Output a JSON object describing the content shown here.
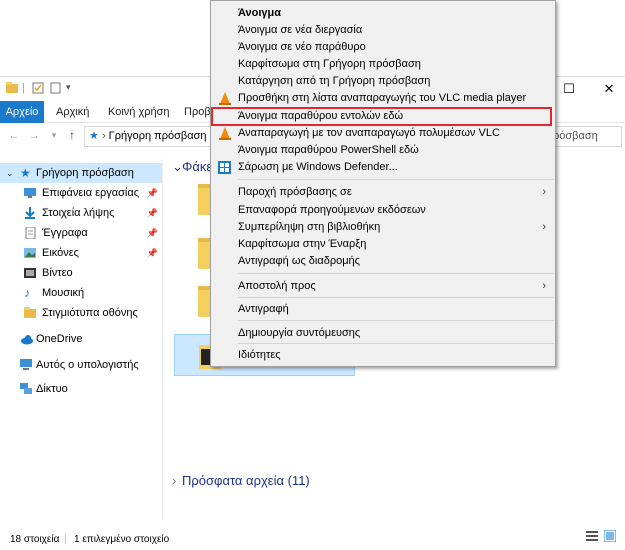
{
  "window": {
    "tabs": [
      "Αρχείο",
      "Αρχική",
      "Κοινή χρήση",
      "Προβ"
    ],
    "address": "Γρήγορη πρόσβαση",
    "search_placeholder": "ρόσβαση"
  },
  "nav": {
    "items": [
      {
        "label": "Γρήγορη πρόσβαση",
        "icon": "star-icon"
      },
      {
        "label": "Επιφάνεια εργασίας",
        "icon": "desktop-icon"
      },
      {
        "label": "Στοιχεία λήψης",
        "icon": "download-icon"
      },
      {
        "label": "Έγγραφα",
        "icon": "documents-icon"
      },
      {
        "label": "Εικόνες",
        "icon": "pictures-icon"
      },
      {
        "label": "Βίντεο",
        "icon": "video-icon"
      },
      {
        "label": "Μουσική",
        "icon": "music-icon"
      },
      {
        "label": "Στιγμιότυπα οθόνης",
        "icon": "folder-icon"
      },
      {
        "label": "OneDrive",
        "icon": "cloud-icon"
      },
      {
        "label": "Αυτός ο υπολογιστής",
        "icon": "computer-icon"
      },
      {
        "label": "Δίκτυο",
        "icon": "network-icon"
      }
    ]
  },
  "content": {
    "group_folders": "Φάκε",
    "group_recent": "Πρόσφατα αρχεία (11)"
  },
  "status": {
    "count": "18 στοιχεία",
    "selected": "1 επιλεγμένο στοιχείο"
  },
  "menu": {
    "items": [
      "Άνοιγμα",
      "Άνοιγμα σε νέα διεργασία",
      "Άνοιγμα σε νέο παράθυρο",
      "Καρφίτσωμα στη Γρήγορη πρόσβαση",
      "Κατάργηση από τη Γρήγορη πρόσβαση",
      "Προσθήκη στη λίστα αναπαραγωγής του VLC media player",
      "Άνοιγμα παραθύρου εντολών εδώ",
      "Αναπαραγωγή με τον αναπαραγωγό πολυμέσων VLC",
      "Άνοιγμα παραθύρου PowerShell εδώ",
      "Σάρωση με Windows Defender...",
      "Παροχή πρόσβασης σε",
      "Επαναφορά προηγούμενων εκδόσεων",
      "Συμπερίληψη στη βιβλιοθήκη",
      "Καρφίτσωμα στην Έναρξη",
      "Αντιγραφή ως διαδρομής",
      "Αποστολή προς",
      "Αντιγραφή",
      "Δημιουργία συντόμευσης",
      "Ιδιότητες"
    ]
  },
  "colors": {
    "accent": "#1979ca",
    "highlight_border": "#e8252d",
    "nav_selected": "#cce8ff"
  }
}
